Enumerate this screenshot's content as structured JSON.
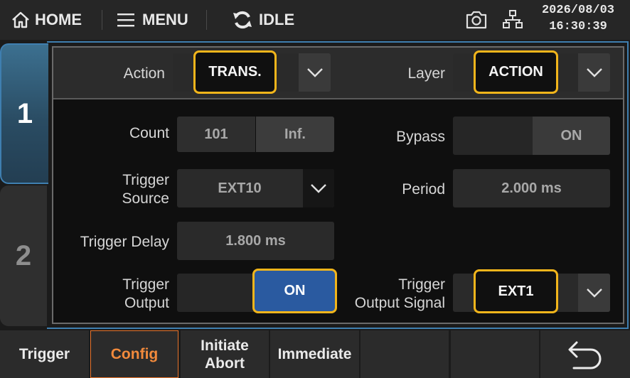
{
  "topbar": {
    "home_label": "HOME",
    "menu_label": "MENU",
    "status_label": "IDLE",
    "date": "2026/08/03",
    "time": "16:30:39"
  },
  "tabs": {
    "tab1": "1",
    "tab2": "2"
  },
  "header": {
    "action_label": "Action",
    "action_value": "TRANS.",
    "layer_label": "Layer",
    "layer_value": "ACTION"
  },
  "fields": {
    "count_label": "Count",
    "count_value": "101",
    "count_inf": "Inf.",
    "bypass_label": "Bypass",
    "bypass_on": "ON",
    "trigger_source_label_1": "Trigger",
    "trigger_source_label_2": "Source",
    "trigger_source_value": "EXT10",
    "period_label": "Period",
    "period_value": "2.000 ms",
    "trigger_delay_label": "Trigger Delay",
    "trigger_delay_value": "1.800 ms",
    "trigger_output_label_1": "Trigger",
    "trigger_output_label_2": "Output",
    "trigger_output_on": "ON",
    "trigger_output_signal_label_1": "Trigger",
    "trigger_output_signal_label_2": "Output Signal",
    "trigger_output_signal_value": "EXT1"
  },
  "softkeys": {
    "trigger": "Trigger",
    "config": "Config",
    "initiate": "Initiate",
    "abort": "Abort",
    "immediate": "Immediate"
  },
  "colors": {
    "accent_blue": "#3f7fb0",
    "highlight_yellow": "#f2b51b",
    "active_orange": "#f28a3c",
    "on_button_blue": "#2a5aa0"
  }
}
